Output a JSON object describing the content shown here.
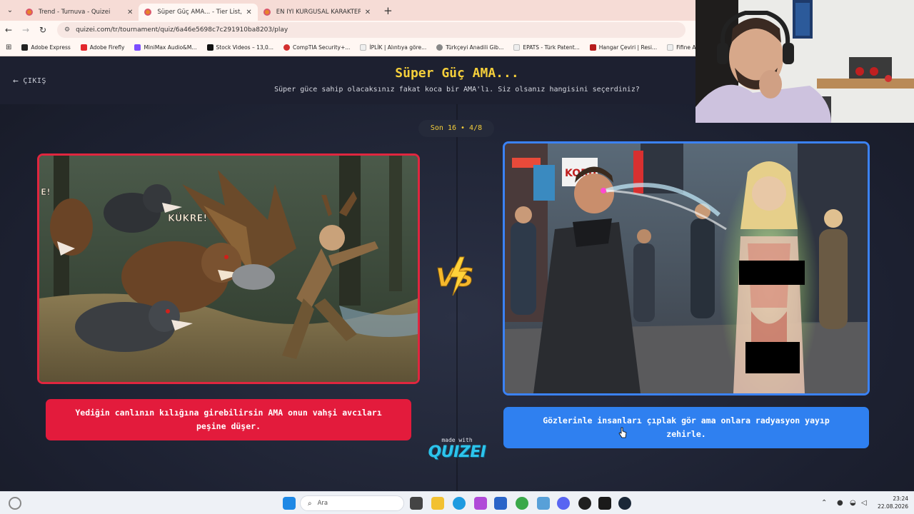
{
  "browser": {
    "tabs": [
      {
        "title": "Trend - Turnuva - Quizei",
        "active": false
      },
      {
        "title": "Süper Güç AMA... - Tier List, Kö",
        "active": true
      },
      {
        "title": "EN İYİ KURGUSAL KARAKTER?",
        "active": false
      }
    ],
    "url": "quizei.com/tr/tournament/quiz/6a46e5698c7c291910ba8203/play",
    "bookmarks": [
      {
        "label": "Adobe Express",
        "color": "#222222"
      },
      {
        "label": "Adobe Firefly",
        "color": "#e3262c"
      },
      {
        "label": "MiniMax Audio&M...",
        "color": "#7c4dff"
      },
      {
        "label": "Stock Videos – 13,0...",
        "color": "#111111"
      },
      {
        "label": "CompTIA Security+...",
        "color": "#d32f2f"
      },
      {
        "label": "İPLİK | Alıntıya göre...",
        "color": "#eeeeee"
      },
      {
        "label": "Türkçeyi Anadili Gib...",
        "color": "#888888"
      },
      {
        "label": "EPATS - Türk Patent...",
        "color": "#eeeeee"
      },
      {
        "label": "Hangar Çeviri | Resi...",
        "color": "#b71c1c"
      },
      {
        "label": "Fifine Ampliga",
        "color": "#eeeeee"
      }
    ]
  },
  "header": {
    "exit_label": "ÇIKIŞ",
    "title": "Süper Güç AMA...",
    "subtitle": "Süper güce sahip olacaksınız fakat koca bir AMA'lı. Siz olsanız hangisini seçerdiniz?"
  },
  "round": {
    "label": "Son 16 • 4/8"
  },
  "choices": {
    "left": {
      "text": "Yediğin canlının kılığına girebilirsin AMA onun vahşi avcıları peşine düşer."
    },
    "right": {
      "text": "Gözlerinle insanları çıplak gör ama onlara radyasyon yayıp zehirle."
    }
  },
  "branding": {
    "made_with": "made with",
    "logo": "QUIZEI"
  },
  "taskbar": {
    "search_placeholder": "Ara",
    "time": "23:24",
    "date": "22.08.2026"
  },
  "colors": {
    "accent_yellow": "#f5cf3b",
    "left_red": "#e31b3c",
    "right_blue": "#2f80f0",
    "brand_cyan": "#2dc4ec"
  }
}
